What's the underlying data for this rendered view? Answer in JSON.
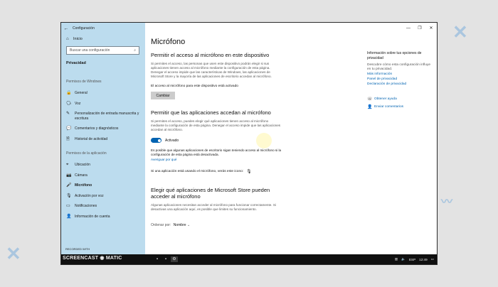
{
  "window": {
    "app_title": "Configuración",
    "controls": [
      "—",
      "❐",
      "✕"
    ]
  },
  "sidebar": {
    "home": "Inicio",
    "search_placeholder": "Buscar una configuración",
    "section": "Privacidad",
    "group_windows": "Permisos de Windows",
    "windows_items": [
      {
        "label": "General",
        "icon": "lock-icon",
        "glyph": "🔒"
      },
      {
        "label": "Voz",
        "icon": "speech-icon",
        "glyph": "🗣"
      },
      {
        "label": "Personalización de entrada manuscrita y escritura",
        "icon": "pen-icon",
        "glyph": "✎"
      },
      {
        "label": "Comentarios y diagnósticos",
        "icon": "feedback-icon",
        "glyph": "💬"
      },
      {
        "label": "Historial de actividad",
        "icon": "history-icon",
        "glyph": "🗎"
      }
    ],
    "group_apps": "Permisos de la aplicación",
    "app_items": [
      {
        "label": "Ubicación",
        "icon": "location-icon",
        "glyph": "⌖"
      },
      {
        "label": "Cámara",
        "icon": "camera-icon",
        "glyph": "📷"
      },
      {
        "label": "Micrófono",
        "icon": "microphone-icon",
        "glyph": "🎤"
      },
      {
        "label": "Activación por voz",
        "icon": "voice-activation-icon",
        "glyph": "🎙"
      },
      {
        "label": "Notificaciones",
        "icon": "notifications-icon",
        "glyph": "▭"
      },
      {
        "label": "Información de cuenta",
        "icon": "account-info-icon",
        "glyph": "👤"
      }
    ]
  },
  "main": {
    "title": "Micrófono",
    "device_heading": "Permitir el acceso al micrófono en este dispositivo",
    "device_desc": "Si permites el acceso, las personas que usen este dispositivo podrán elegir si sus aplicaciones tienen acceso al micrófono mediante la configuración de esta página. Denegar el acceso impide que las características de Windows, las aplicaciones de Microsoft Store y la mayoría de las aplicaciones de escritorio accedan al micrófono.",
    "device_status": "El acceso al micrófono para este dispositivo está activado",
    "change_button": "Cambiar",
    "apps_heading": "Permitir que las aplicaciones accedan al micrófono",
    "apps_desc": "Si permites el acceso, puedes elegir qué aplicaciones tienen acceso al micrófono mediante la configuración de esta página. Denegar el acceso impide que las aplicaciones accedan al micrófono.",
    "toggle_label": "Activado",
    "desktop_note": "Es posible que algunas aplicaciones de escritorio sigan teniendo acceso al micrófono si la configuración de esta página está desactivada.",
    "learn_why": "Averiguar por qué",
    "icon_note": "Si una aplicación está usando el micrófono, verás este icono:",
    "store_heading": "Elegir qué aplicaciones de Microsoft Store pueden acceder al micrófono",
    "store_desc": "Algunas aplicaciones necesitan acceder al micrófono para funcionar correctamente. Si desactivas una aplicación aquí, es posible que limites su funcionamiento.",
    "sort_label": "Ordenar por:",
    "sort_value": "Nombre"
  },
  "right_panel": {
    "title": "Información sobre tus opciones de privacidad",
    "desc": "Descubre cómo esta configuración influye en tu privacidad.",
    "links": [
      "Más información",
      "Panel de privacidad",
      "Declaración de privacidad"
    ],
    "help": "Obtener ayuda",
    "feedback": "Enviar comentarios"
  },
  "taskbar": {
    "watermark": "SCREENCAST ◉ MATIC",
    "watermark_small": "RECORDED WITH",
    "lang": "ESP",
    "time": "12:49"
  }
}
